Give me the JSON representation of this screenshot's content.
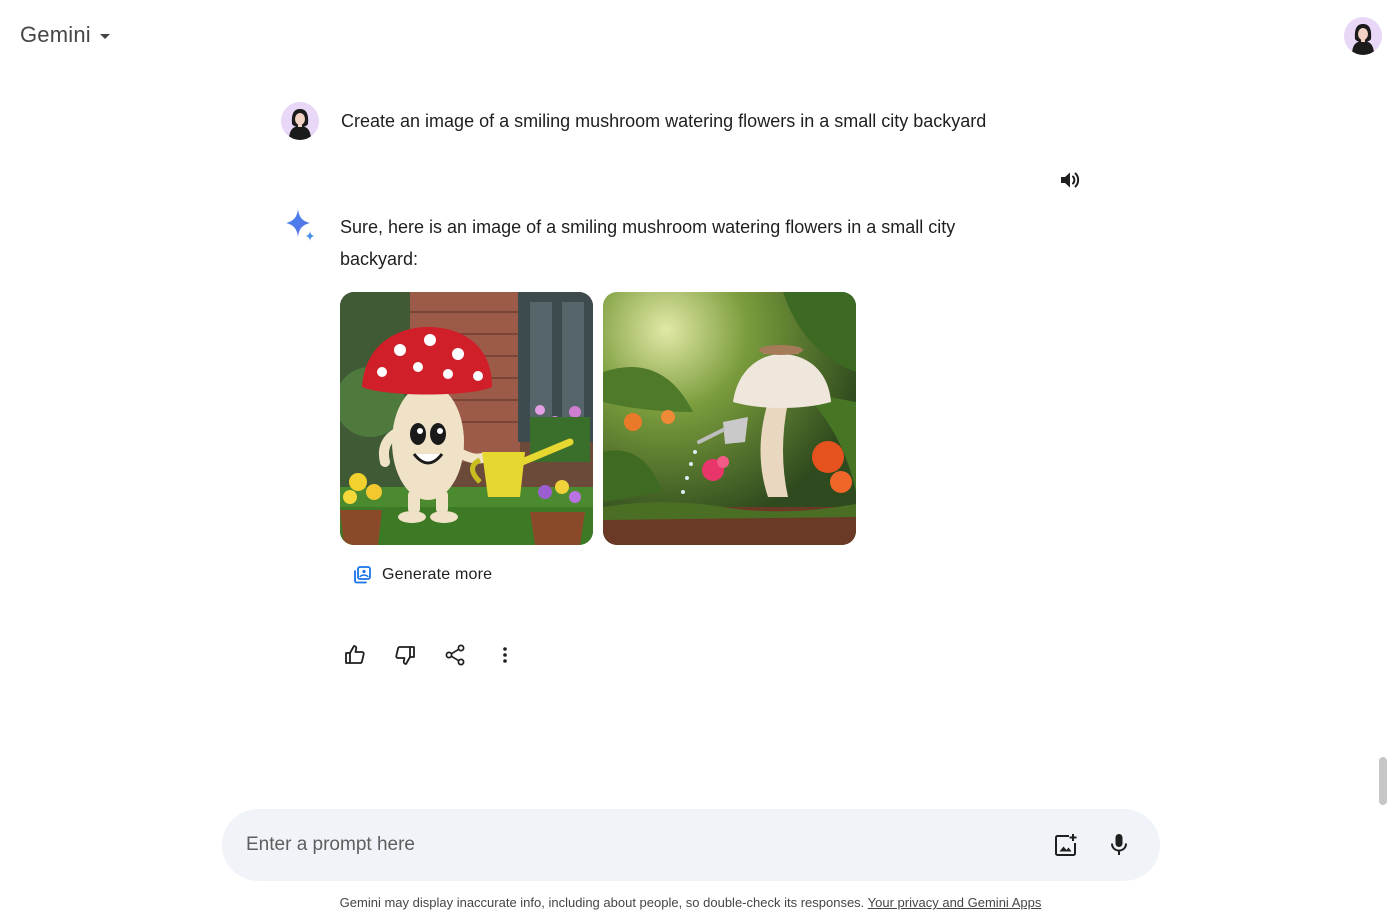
{
  "header": {
    "app_title": "Gemini",
    "switcher_icon": "caret-down-icon",
    "avatar_icon": "user-avatar"
  },
  "conversation": {
    "user_prompt": "Create an image of a smiling mushroom watering flowers in a small city backyard",
    "response_text": "Sure, here is an image of a smiling mushroom watering flowers in a small city backyard:",
    "generate_more_label": "Generate more",
    "speaker_icon": "volume-icon",
    "actions": [
      "thumbs-up-icon",
      "thumbs-down-icon",
      "share-icon",
      "more-vert-icon"
    ]
  },
  "prompt_bar": {
    "placeholder": "Enter a prompt here",
    "upload_icon": "add-image-icon",
    "mic_icon": "microphone-icon"
  },
  "footer": {
    "disclaimer": "Gemini may display inaccurate info, including about people, so double-check its responses. ",
    "link_text": "Your privacy and Gemini Apps"
  },
  "colors": {
    "prompt_bg": "#f0f4f9",
    "avatar_bg": "#e9d7f7",
    "sparkle_blue": "#4285f4"
  }
}
